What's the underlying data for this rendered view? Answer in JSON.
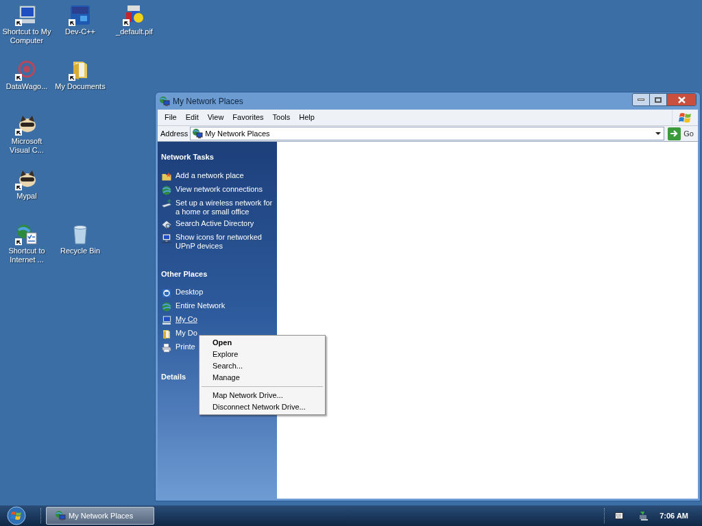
{
  "desktop": {
    "icons": [
      {
        "label": "Shortcut to My Computer",
        "kind": "computer",
        "shortcut": true
      },
      {
        "label": "Dev-C++",
        "kind": "dev",
        "shortcut": true
      },
      {
        "label": "_default.pif",
        "kind": "msdos",
        "shortcut": true
      },
      {
        "label": "DataWago...",
        "kind": "target",
        "shortcut": true
      },
      {
        "label": "My Documents",
        "kind": "folder",
        "shortcut": true
      },
      {
        "label": "Microsoft Visual C...",
        "kind": "raccoon",
        "shortcut": true
      },
      {
        "label": "Mypal",
        "kind": "raccoon",
        "shortcut": true
      },
      {
        "label": "Shortcut to Internet ...",
        "kind": "globe-doc",
        "shortcut": true
      },
      {
        "label": "Recycle Bin",
        "kind": "bin",
        "shortcut": false
      }
    ]
  },
  "window": {
    "title": "My Network Places",
    "menu": [
      "File",
      "Edit",
      "View",
      "Favorites",
      "Tools",
      "Help"
    ],
    "address": {
      "label": "Address",
      "value": "My Network Places",
      "go": "Go"
    },
    "sidebar": {
      "sections": [
        {
          "title": "Network Tasks",
          "items": [
            {
              "label": "Add a network place",
              "hovered": false
            },
            {
              "label": "View network connections",
              "hovered": false
            },
            {
              "label": "Set up a wireless network for a home or small office",
              "hovered": false
            },
            {
              "label": "Search Active Directory",
              "hovered": false
            },
            {
              "label": "Show icons for networked UPnP devices",
              "hovered": false
            }
          ]
        },
        {
          "title": "Other Places",
          "items": [
            {
              "label": "Desktop",
              "hovered": false
            },
            {
              "label": "Entire Network",
              "hovered": false
            },
            {
              "label": "My Co",
              "hovered": true
            },
            {
              "label": "My Do",
              "hovered": false
            },
            {
              "label": "Printe",
              "hovered": false
            }
          ]
        },
        {
          "title": "Details"
        }
      ]
    }
  },
  "context_menu": [
    {
      "kind": "item",
      "label": "Open",
      "default": true
    },
    {
      "kind": "item",
      "label": "Explore",
      "default": false
    },
    {
      "kind": "item",
      "label": "Search...",
      "default": false
    },
    {
      "kind": "item",
      "label": "Manage",
      "default": false
    },
    {
      "kind": "separator"
    },
    {
      "kind": "item",
      "label": "Map Network Drive...",
      "default": false
    },
    {
      "kind": "item",
      "label": "Disconnect Network Drive...",
      "default": false
    }
  ],
  "taskbar": {
    "tasks": [
      {
        "label": "My Network Places",
        "selected": true
      }
    ],
    "clock": "7:06 AM"
  }
}
